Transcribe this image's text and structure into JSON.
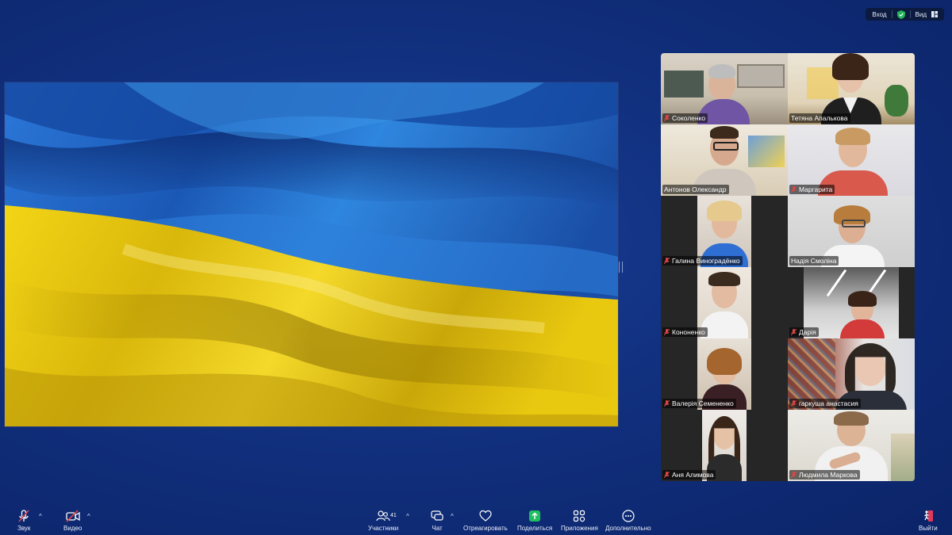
{
  "topbar": {
    "login_label": "Вход",
    "view_label": "Вид"
  },
  "share": {
    "description_icon": "flag-of-ukraine"
  },
  "colors": {
    "accent": "#1f8b4c",
    "muted": "#e04646",
    "flag_blue": "#1e63c9",
    "flag_yellow": "#f1d21a"
  },
  "participants": [
    {
      "name": "Соколенко",
      "muted": true
    },
    {
      "name": "Тетяна Апалькова",
      "muted": false
    },
    {
      "name": "Антонов Олександр",
      "muted": false
    },
    {
      "name": "Маргарита",
      "muted": true
    },
    {
      "name": "Галина Виноградёнко",
      "muted": true
    },
    {
      "name": "Надія Смоліна",
      "muted": false
    },
    {
      "name": "Кононенко",
      "muted": true
    },
    {
      "name": "Дарія",
      "muted": true
    },
    {
      "name": "Валерія Семененко",
      "muted": true
    },
    {
      "name": "гаркуша анастасия",
      "muted": true
    },
    {
      "name": "Аня Алимова",
      "muted": true
    },
    {
      "name": "Людмила Маркова",
      "muted": true
    }
  ],
  "toolbar": {
    "audio_label": "Звук",
    "video_label": "Видео",
    "participants_label": "Участники",
    "participants_count": "41",
    "chat_label": "Чат",
    "react_label": "Отреагировать",
    "share_label": "Поделиться",
    "apps_label": "Приложения",
    "more_label": "Дополнительно",
    "leave_label": "Выйти"
  }
}
